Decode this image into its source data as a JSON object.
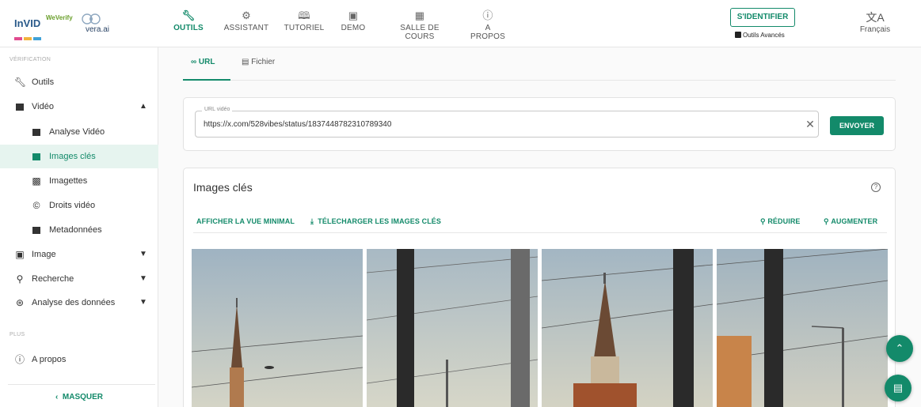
{
  "header": {
    "logo": {
      "invid": "InVID",
      "weverify": "WeVerify",
      "vera": "vera.ai"
    },
    "nav": [
      {
        "label": "OUTILS",
        "icon": "wrench-icon",
        "active": true
      },
      {
        "label": "ASSISTANT",
        "icon": "robot-icon",
        "active": false
      },
      {
        "label": "TUTORIEL",
        "icon": "book-icon",
        "active": false
      },
      {
        "label": "DEMO",
        "icon": "video-icon",
        "active": false
      },
      {
        "label": "SALLE DE COURS",
        "icon": "classroom-icon",
        "active": false
      },
      {
        "label": "A PROPOS",
        "icon": "info-icon",
        "active": false
      }
    ],
    "signin_label": "S'IDENTIFIER",
    "advanced_label": "Outils Avancés",
    "language_label": "Français"
  },
  "sidebar": {
    "section_verification": "VÉRIFICATION",
    "items": [
      {
        "label": "Outils",
        "icon": "wrench-icon"
      },
      {
        "label": "Vidéo",
        "icon": "film-icon",
        "chevron": "up"
      },
      {
        "label": "Analyse Vidéo",
        "icon": "video-analysis-icon"
      },
      {
        "label": "Images clés",
        "icon": "keyframes-icon",
        "selected": true
      },
      {
        "label": "Imagettes",
        "icon": "thumbnails-icon"
      },
      {
        "label": "Droits vidéo",
        "icon": "copyright-icon"
      },
      {
        "label": "Metadonnées",
        "icon": "metadata-icon"
      },
      {
        "label": "Image",
        "icon": "image-icon",
        "chevron": "down"
      },
      {
        "label": "Recherche",
        "icon": "search-icon",
        "chevron": "down"
      },
      {
        "label": "Analyse des données",
        "icon": "data-analysis-icon",
        "chevron": "down"
      }
    ],
    "section_plus": "PLUS",
    "about_label": "A propos",
    "hide_label": "MASQUER"
  },
  "tabs": [
    {
      "label": "URL",
      "icon": "link-icon",
      "active": true
    },
    {
      "label": "Fichier",
      "icon": "file-upload-icon",
      "active": false
    }
  ],
  "url_form": {
    "field_label": "URL vidéo",
    "value": "https://x.com/528vibes/status/1837448782310789340",
    "submit_label": "ENVOYER"
  },
  "keyframes": {
    "title": "Images clés",
    "actions": {
      "minimal_view": "AFFICHER LA VUE MINIMAL",
      "download": "TÉLECHARGER LES IMAGES CLÉS",
      "reduce": "RÉDUIRE",
      "increase": "AUGMENTER"
    }
  },
  "colors": {
    "accent": "#138a6a",
    "selected_bg": "#e6f4ef"
  }
}
